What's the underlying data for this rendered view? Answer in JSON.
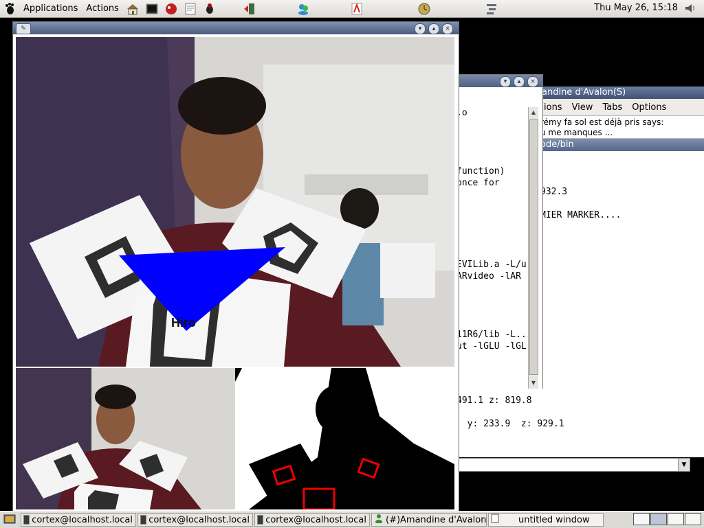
{
  "top_panel": {
    "menu_applications": "Applications",
    "menu_actions": "Actions",
    "clock": "Thu May 26, 15:18",
    "launchers": [
      "home-icon",
      "terminal-icon",
      "mozilla-icon",
      "text-editor-icon",
      "bug-icon",
      "logout-icon",
      "messenger-icon",
      "pdf-icon",
      "clock-app-icon",
      "network-icon"
    ]
  },
  "terminal": {
    "lines": [
      ".o",
      "",
      "",
      "",
      "",
      "function)",
      "once for",
      "",
      "",
      "",
      "",
      "",
      "",
      "EVILib.a -L/u",
      "ARvideo -lAR",
      "",
      "",
      "",
      "",
      "11R6/lib -L..",
      "ut -lGLU -lGL"
    ]
  },
  "chat": {
    "title": "andine d'Avalon(S)",
    "menus": [
      "ions",
      "View",
      "Tabs",
      "Options"
    ],
    "messages": [
      "rémy fa sol est déjà pris says:",
      "u me manques ..."
    ],
    "path": "ode/bin",
    "body_lines": [
      "",
      "",
      "",
      "932.3",
      "",
      "MIER MARKER....",
      "",
      "",
      "",
      "",
      "",
      "",
      "",
      "",
      "",
      ""
    ]
  },
  "bottom_terminal": {
    "line1": "491.1  z: 819.8",
    "line2": "  y: 233.9  z: 929.1"
  },
  "video": {
    "marker_label": "Hiro"
  },
  "taskbar": {
    "tasks": [
      "cortex@localhost.local",
      "cortex@localhost.local",
      "cortex@localhost.local",
      "(#)Amandine d'Avalon",
      "untitled window"
    ]
  }
}
